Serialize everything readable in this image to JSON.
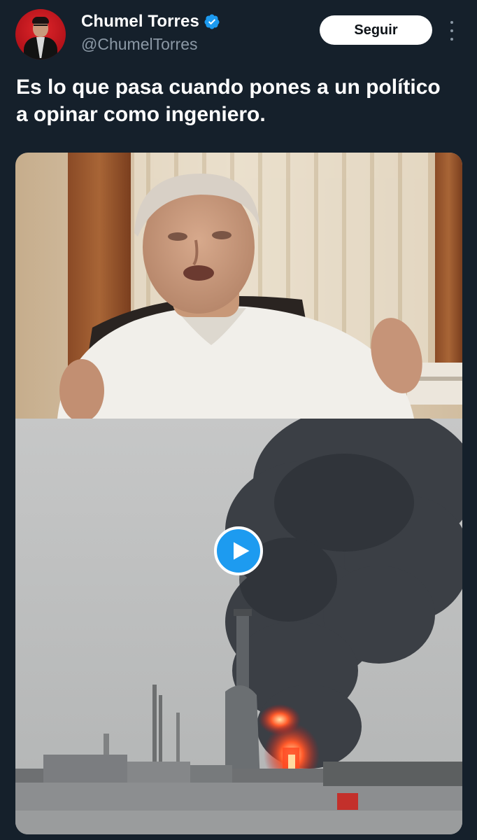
{
  "tweet": {
    "author": {
      "display_name": "Chumel Torres",
      "handle": "@ChumelTorres",
      "verified": true,
      "avatar_icon": "avatar-image"
    },
    "follow_button_label": "Seguir",
    "more_icon": "more-vertical-icon",
    "text": "Es lo que pasa cuando pones a un político a opinar como ingeniero.",
    "media": {
      "type": "video",
      "play_icon": "play-icon",
      "accent_color": "#1d9bf0"
    }
  },
  "colors": {
    "background": "#15202b",
    "text_primary": "#ffffff",
    "text_secondary": "#8b98a5",
    "verified_badge": "#1d9bf0"
  }
}
